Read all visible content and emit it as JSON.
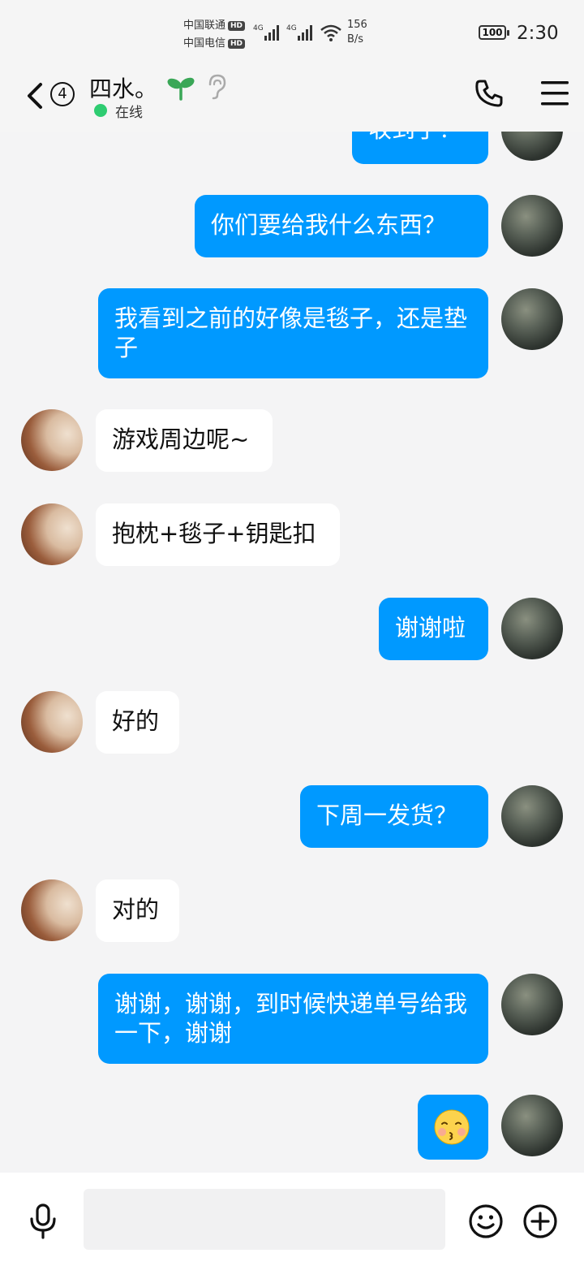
{
  "status_bar": {
    "carrier_1": "中国联通",
    "carrier_2": "中国电信",
    "hd_label": "HD",
    "network_label": "4G",
    "speed_value": "156",
    "speed_unit": "B/s",
    "battery": "100",
    "time": "2:30"
  },
  "header": {
    "unread_count": "4",
    "contact_name": "四水。",
    "online_status": "在线",
    "icons": [
      "back-icon",
      "sprout-icon",
      "ear-icon",
      "phone-icon",
      "menu-icon"
    ]
  },
  "messages": [
    {
      "sender": "me",
      "text": "收到了？"
    },
    {
      "sender": "me",
      "text": "你们要给我什么东西？"
    },
    {
      "sender": "me",
      "text": "我看到之前的好像是毯子，还是垫子"
    },
    {
      "sender": "other",
      "text": "游戏周边呢~"
    },
    {
      "sender": "other",
      "text": "抱枕+毯子+钥匙扣"
    },
    {
      "sender": "me",
      "text": "谢谢啦"
    },
    {
      "sender": "other",
      "text": "好的"
    },
    {
      "sender": "me",
      "text": "下周一发货？"
    },
    {
      "sender": "other",
      "text": "对的"
    },
    {
      "sender": "me",
      "text": "谢谢，谢谢，到时候快递单号给我一下，谢谢"
    },
    {
      "sender": "me",
      "text": "",
      "emoji": "kissing-face-emoji"
    }
  ],
  "input_bar": {
    "placeholder": "",
    "icons": [
      "microphone-icon",
      "emoji-icon",
      "plus-icon"
    ]
  },
  "colors": {
    "my_bubble": "#0099ff",
    "other_bubble": "#ffffff",
    "background": "#f4f4f5",
    "online_dot": "#2ecc71"
  }
}
